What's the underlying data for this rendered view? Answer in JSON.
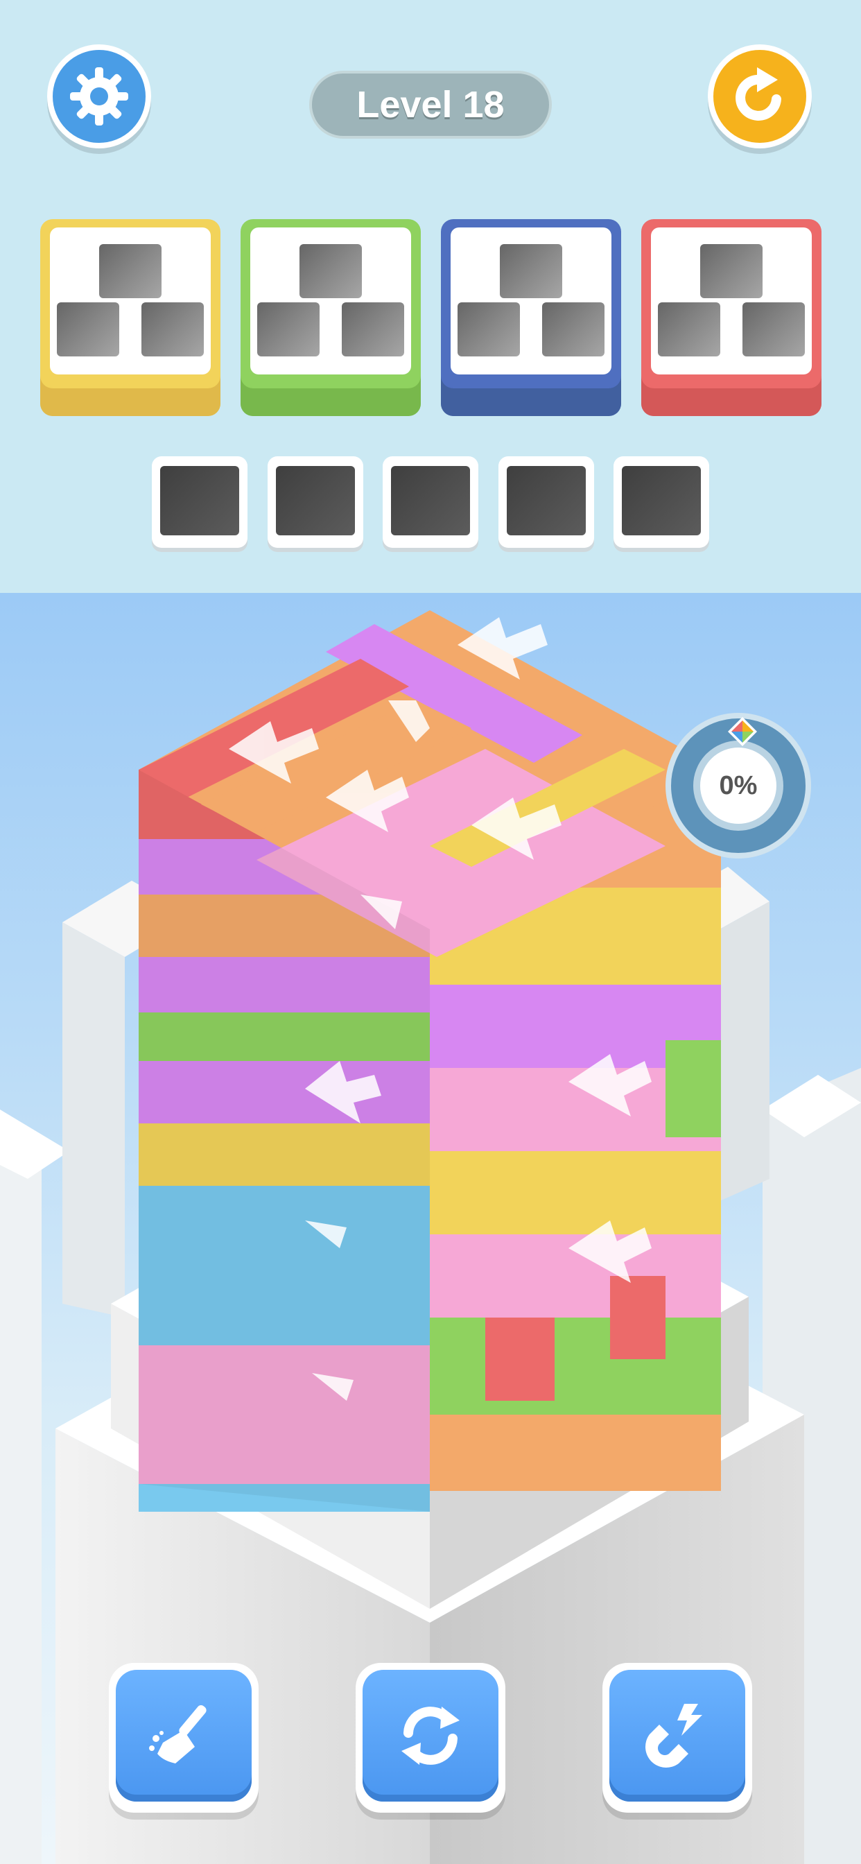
{
  "hud": {
    "level_label": "Level 18",
    "progress_label": "0%",
    "progress_value": 0
  },
  "icons": {
    "settings": "gear-icon",
    "restart": "restart-icon",
    "progress_gem": "color-gem-icon",
    "broom": "broom-icon",
    "shuffle": "shuffle-icon",
    "magnet": "magnet-icon"
  },
  "goal_boxes": [
    {
      "color": "#f2d35a",
      "slots": 3,
      "filled": 0
    },
    {
      "color": "#8fd25f",
      "slots": 3,
      "filled": 0
    },
    {
      "color": "#4f6fc0",
      "slots": 3,
      "filled": 0
    },
    {
      "color": "#ec6a6a",
      "slots": 3,
      "filled": 0
    }
  ],
  "tray": {
    "slots": 5,
    "filled": 0
  },
  "block_colors": [
    "#ec6a6a",
    "#f3a96a",
    "#d787f2",
    "#f6a8d6",
    "#f2d35a",
    "#8fd25f",
    "#79c9ee"
  ]
}
